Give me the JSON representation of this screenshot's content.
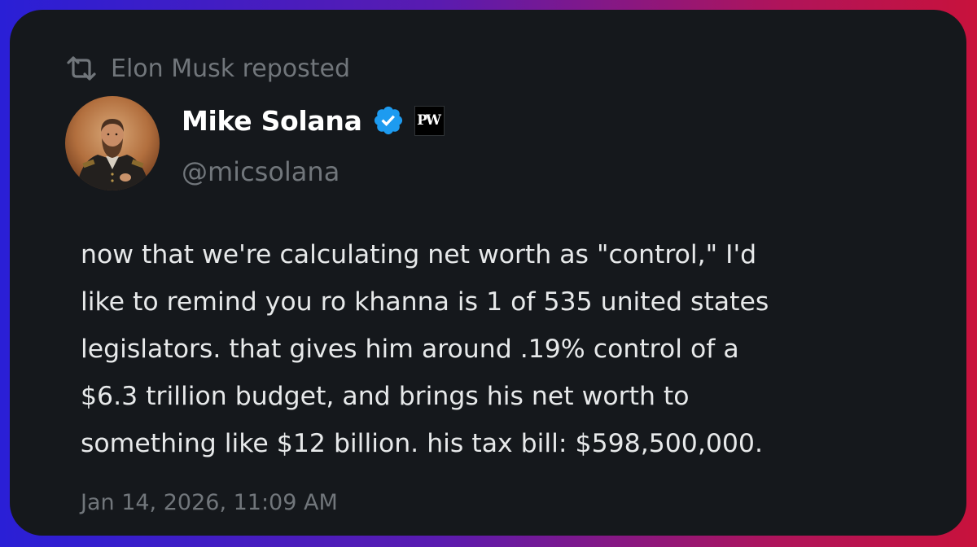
{
  "repost": {
    "label": "Elon Musk reposted",
    "icon": "repost-icon"
  },
  "author": {
    "display_name": "Mike Solana",
    "handle": "@micsolana",
    "verified": true,
    "verified_color": "#1d9bf0",
    "affiliate_badge": "PW",
    "avatar": "portrait-avatar"
  },
  "tweet": {
    "text": "now that we're calculating net worth as \"control,\" I'd\nlike to remind you ro khanna is 1 of 535 united states\nlegislators. that gives him around .19% control of a\n$6.3 trillion budget, and brings his net worth to\nsomething like $12 billion. his tax bill: $598,500,000.",
    "timestamp": "Jan 14, 2026, 11:09 AM"
  },
  "colors": {
    "card_bg": "#15181c",
    "text_primary": "#e7e9ea",
    "text_secondary": "#71767b"
  }
}
